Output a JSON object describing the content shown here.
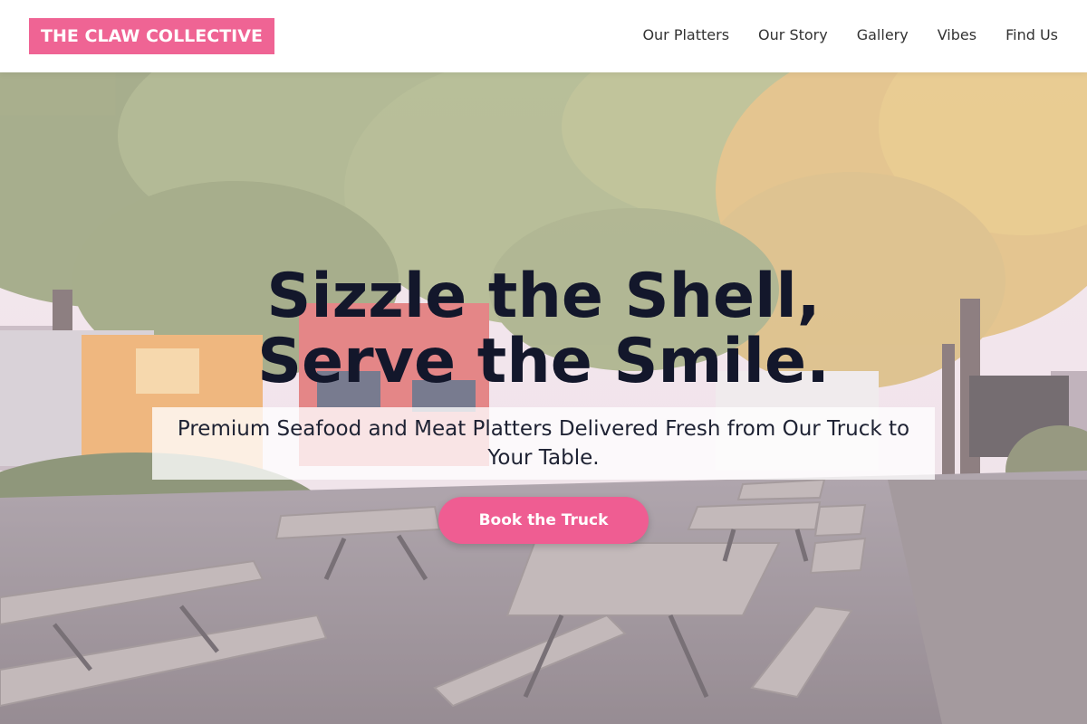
{
  "header": {
    "logo_text": "THE CLAW COLLECTIVE",
    "nav": [
      {
        "label": "Our Platters"
      },
      {
        "label": "Our Story"
      },
      {
        "label": "Gallery"
      },
      {
        "label": "Vibes"
      },
      {
        "label": "Find Us"
      }
    ]
  },
  "hero": {
    "headline_line1": "Sizzle the Shell,",
    "headline_line2": "Serve the Smile.",
    "subtitle": "Premium Seafood and Meat Platters Delivered Fresh from Our Truck to Your Table.",
    "cta_label": "Book the Truck",
    "background_image": "food-truck-park-photo"
  },
  "colors": {
    "brand_pink": "#ef6494",
    "cta_pink": "#ef5d92",
    "headline": "#13172b",
    "nav_text": "#333333"
  }
}
